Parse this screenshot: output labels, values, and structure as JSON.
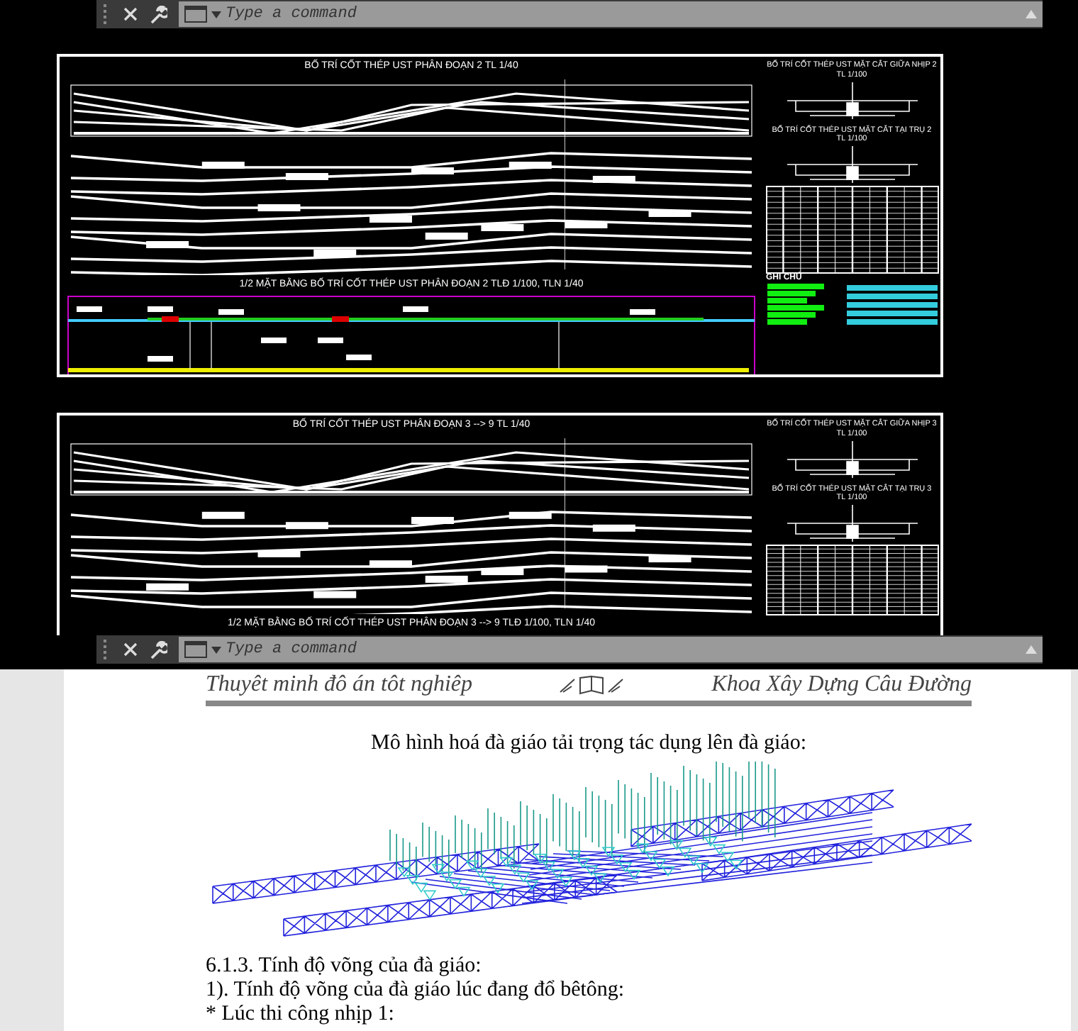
{
  "command_bars": [
    {
      "placeholder": "Type a command"
    },
    {
      "placeholder": "Type a command"
    }
  ],
  "sheets": [
    {
      "title": "BỐ TRÍ CỐT THÉP UST PHÂN ĐOẠN 2 TL 1/40",
      "sections": [
        {
          "title": "BỐ TRÍ CỐT THÉP UST MẶT CẮT GIỮA NHỊP 2",
          "scale": "TL 1/100"
        },
        {
          "title": "BỐ TRÍ CỐT THÉP UST MẶT CẮT TẠI TRỤ 2",
          "scale": "TL 1/100"
        }
      ],
      "plan_title": "1/2 MẶT BẰNG BỐ TRÍ CỐT THÉP UST PHÂN ĐOẠN 2 TLĐ 1/100, TLN 1/40",
      "notes_label": "GHI CHÚ"
    },
    {
      "title": "BỐ TRÍ CỐT THÉP UST PHÂN ĐOẠN 3 --> 9 TL 1/40",
      "sections": [
        {
          "title": "BỐ TRÍ CỐT THÉP UST MẶT CẮT GIỮA NHỊP 3",
          "scale": "TL 1/100"
        },
        {
          "title": "BỐ TRÍ CỐT THÉP UST MẶT CẮT TẠI TRỤ 3",
          "scale": "TL 1/100"
        }
      ],
      "plan_title": "1/2 MẶT BẰNG BỐ TRÍ CỐT THÉP UST PHÂN ĐOẠN 3 --> 9 TLĐ 1/100, TLN 1/40"
    }
  ],
  "document": {
    "header": {
      "title": "Thuyêt minh đô án tôt nghiêp",
      "department": "Khoa Xây Dựng Câu Đường"
    },
    "figure_caption": "Mô hình hoá đà giáo tải trọng tác dụng lên đà giáo:",
    "paragraphs": [
      "6.1.3. Tính độ võng của đà giáo:",
      "1). Tính độ võng của đà giáo lúc đang đổ bêtông:",
      "* Lúc thi công nhịp 1:"
    ]
  }
}
